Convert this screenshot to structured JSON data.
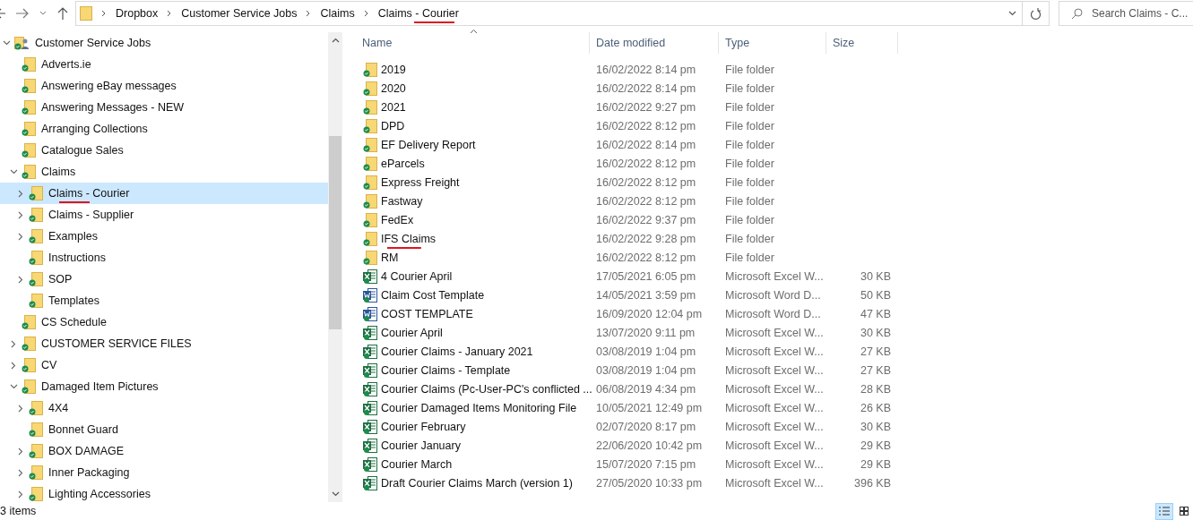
{
  "address_bar": {
    "breadcrumbs": [
      {
        "label": "Dropbox",
        "underlined": false
      },
      {
        "label": "Customer Service Jobs",
        "underlined": false
      },
      {
        "label": "Claims",
        "underlined": false
      },
      {
        "label": "Claims - Courier",
        "underlined": true
      }
    ]
  },
  "search": {
    "placeholder": "Search Claims - C..."
  },
  "tree": {
    "label": "Customer Service Jobs",
    "kind": "shared",
    "expandable": true,
    "expanded": true,
    "selected": false,
    "underlined": false,
    "children": [
      {
        "label": "Adverts.ie",
        "kind": "folder",
        "expandable": false,
        "expanded": false,
        "selected": false,
        "underlined": false
      },
      {
        "label": "Answering eBay messages",
        "kind": "folder",
        "expandable": false,
        "expanded": false,
        "selected": false,
        "underlined": false
      },
      {
        "label": "Answering Messages - NEW",
        "kind": "folder",
        "expandable": false,
        "expanded": false,
        "selected": false,
        "underlined": false
      },
      {
        "label": "Arranging Collections",
        "kind": "folder",
        "expandable": false,
        "expanded": false,
        "selected": false,
        "underlined": false
      },
      {
        "label": "Catalogue Sales",
        "kind": "folder",
        "expandable": false,
        "expanded": false,
        "selected": false,
        "underlined": false
      },
      {
        "label": "Claims",
        "kind": "folder",
        "expandable": true,
        "expanded": true,
        "selected": false,
        "underlined": false,
        "children": [
          {
            "label": "Claims - Courier",
            "kind": "folder",
            "expandable": true,
            "expanded": false,
            "selected": true,
            "underlined": true
          },
          {
            "label": "Claims - Supplier",
            "kind": "folder",
            "expandable": true,
            "expanded": false,
            "selected": false,
            "underlined": false
          },
          {
            "label": "Examples",
            "kind": "folder",
            "expandable": true,
            "expanded": false,
            "selected": false,
            "underlined": false
          },
          {
            "label": "Instructions",
            "kind": "folder",
            "expandable": false,
            "expanded": false,
            "selected": false,
            "underlined": false
          },
          {
            "label": "SOP",
            "kind": "folder",
            "expandable": true,
            "expanded": false,
            "selected": false,
            "underlined": false
          },
          {
            "label": "Templates",
            "kind": "folder",
            "expandable": false,
            "expanded": false,
            "selected": false,
            "underlined": false
          }
        ]
      },
      {
        "label": "CS Schedule",
        "kind": "folder",
        "expandable": false,
        "expanded": false,
        "selected": false,
        "underlined": false
      },
      {
        "label": "CUSTOMER SERVICE FILES",
        "kind": "folder",
        "expandable": true,
        "expanded": false,
        "selected": false,
        "underlined": false
      },
      {
        "label": "CV",
        "kind": "folder",
        "expandable": true,
        "expanded": false,
        "selected": false,
        "underlined": false
      },
      {
        "label": "Damaged Item Pictures",
        "kind": "folder",
        "expandable": true,
        "expanded": true,
        "selected": false,
        "underlined": false,
        "children": [
          {
            "label": "4X4",
            "kind": "folder",
            "expandable": true,
            "expanded": false,
            "selected": false,
            "underlined": false
          },
          {
            "label": "Bonnet Guard",
            "kind": "folder",
            "expandable": false,
            "expanded": false,
            "selected": false,
            "underlined": false
          },
          {
            "label": "BOX DAMAGE",
            "kind": "folder",
            "expandable": true,
            "expanded": false,
            "selected": false,
            "underlined": false
          },
          {
            "label": "Inner Packaging",
            "kind": "folder",
            "expandable": true,
            "expanded": false,
            "selected": false,
            "underlined": false
          },
          {
            "label": "Lighting Accessories",
            "kind": "folder",
            "expandable": true,
            "expanded": false,
            "selected": false,
            "underlined": false
          }
        ]
      }
    ]
  },
  "columns": [
    {
      "label": "Name",
      "sorted": true
    },
    {
      "label": "Date modified",
      "sorted": false
    },
    {
      "label": "Type",
      "sorted": false
    },
    {
      "label": "Size",
      "sorted": false
    }
  ],
  "files": [
    {
      "name": "2019",
      "date": "16/02/2022 8:14 pm",
      "type": "File folder",
      "kind": "folder",
      "underlined": false
    },
    {
      "name": "2020",
      "date": "16/02/2022 8:14 pm",
      "type": "File folder",
      "kind": "folder",
      "underlined": false
    },
    {
      "name": "2021",
      "date": "16/02/2022 9:27 pm",
      "type": "File folder",
      "kind": "folder",
      "underlined": false
    },
    {
      "name": "DPD",
      "date": "16/02/2022 8:12 pm",
      "type": "File folder",
      "kind": "folder",
      "underlined": false
    },
    {
      "name": "EF Delivery Report",
      "date": "16/02/2022 8:14 pm",
      "type": "File folder",
      "kind": "folder",
      "underlined": false
    },
    {
      "name": "eParcels",
      "date": "16/02/2022 8:12 pm",
      "type": "File folder",
      "kind": "folder",
      "underlined": false
    },
    {
      "name": "Express Freight",
      "date": "16/02/2022 8:12 pm",
      "type": "File folder",
      "kind": "folder",
      "underlined": false
    },
    {
      "name": "Fastway",
      "date": "16/02/2022 8:12 pm",
      "type": "File folder",
      "kind": "folder",
      "underlined": false
    },
    {
      "name": "FedEx",
      "date": "16/02/2022 9:37 pm",
      "type": "File folder",
      "kind": "folder",
      "underlined": false
    },
    {
      "name": "IFS Claims",
      "date": "16/02/2022 9:28 pm",
      "type": "File folder",
      "kind": "folder",
      "underlined": true
    },
    {
      "name": "RM",
      "date": "16/02/2022 8:12 pm",
      "type": "File folder",
      "kind": "folder",
      "underlined": false
    },
    {
      "name": "4 Courier April",
      "date": "17/05/2021 6:05 pm",
      "type": "Microsoft Excel W...",
      "size": "30 KB",
      "kind": "excel",
      "underlined": false
    },
    {
      "name": "Claim Cost Template",
      "date": "14/05/2021 3:59 pm",
      "type": "Microsoft Word D...",
      "size": "50 KB",
      "kind": "word",
      "underlined": false
    },
    {
      "name": "COST TEMPLATE",
      "date": "16/09/2020 12:04 pm",
      "type": "Microsoft Word D...",
      "size": "47 KB",
      "kind": "word",
      "underlined": false
    },
    {
      "name": "Courier April",
      "date": "13/07/2020 9:11 pm",
      "type": "Microsoft Excel W...",
      "size": "30 KB",
      "kind": "excel",
      "underlined": false
    },
    {
      "name": "Courier Claims - January 2021",
      "date": "03/08/2019 1:04 pm",
      "type": "Microsoft Excel W...",
      "size": "27 KB",
      "kind": "excel",
      "underlined": false
    },
    {
      "name": "Courier Claims - Template",
      "date": "03/08/2019 1:04 pm",
      "type": "Microsoft Excel W...",
      "size": "27 KB",
      "kind": "excel",
      "underlined": false
    },
    {
      "name": "Courier Claims (Pc-User-PC's conflicted ...",
      "date": "06/08/2019 4:34 pm",
      "type": "Microsoft Excel W...",
      "size": "28 KB",
      "kind": "excel",
      "underlined": false
    },
    {
      "name": "Courier Damaged Items Monitoring File",
      "date": "10/05/2021 12:49 pm",
      "type": "Microsoft Excel W...",
      "size": "26 KB",
      "kind": "excel",
      "underlined": false
    },
    {
      "name": "Courier February",
      "date": "02/07/2020 8:17 pm",
      "type": "Microsoft Excel W...",
      "size": "30 KB",
      "kind": "excel",
      "underlined": false
    },
    {
      "name": "Courier January",
      "date": "22/06/2020 10:42 pm",
      "type": "Microsoft Excel W...",
      "size": "29 KB",
      "kind": "excel",
      "underlined": false
    },
    {
      "name": "Courier March",
      "date": "15/07/2020 7:15 pm",
      "type": "Microsoft Excel W...",
      "size": "29 KB",
      "kind": "excel",
      "underlined": false
    },
    {
      "name": "Draft Courier Claims March (version 1)",
      "date": "27/05/2020 10:33 pm",
      "type": "Microsoft Excel W...",
      "size": "396 KB",
      "kind": "excel",
      "underlined": false
    }
  ],
  "status_bar": {
    "item_count": "3 items"
  },
  "view_buttons": [
    {
      "kind": "details",
      "selected": true
    },
    {
      "kind": "tiles",
      "selected": false
    }
  ]
}
